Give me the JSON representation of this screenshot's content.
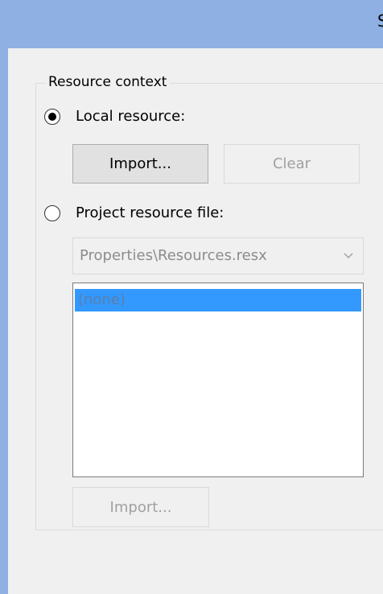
{
  "window": {
    "title_fragment": "S"
  },
  "resource_context": {
    "group_label": "Resource context",
    "local_resource": {
      "label": "Local resource:",
      "selected": true,
      "import_label": "Import...",
      "clear_label": "Clear"
    },
    "project_resource": {
      "label": "Project resource file:",
      "selected": false,
      "file_selected": "Properties\\Resources.resx",
      "list_items": [
        "(none)"
      ],
      "selected_item": "(none)",
      "import_label": "Import..."
    }
  },
  "colors": {
    "title_bar": "#8fb0e3",
    "selection": "#3399ff",
    "background": "#f0f0f0"
  },
  "icons": {
    "combo_arrow": "chevron-down-icon"
  }
}
